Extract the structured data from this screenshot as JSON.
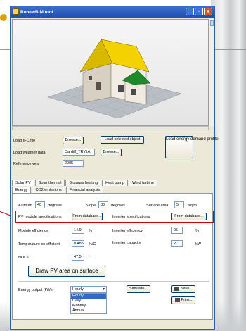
{
  "window": {
    "title": "RenewBIM tool",
    "controls": [
      "_",
      "▫",
      "x"
    ]
  },
  "top": {
    "load_ifc_label": "Load IFC file",
    "browse_label": "Browse...",
    "load_selected_label": "Load selected object",
    "load_energy_label": "Load energy demand profile",
    "weather_label": "Load weather data",
    "weather_value": "Cardiff_TRY.txt",
    "browse2_label": "Browse...",
    "ref_year_label": "Reference year",
    "ref_year_value": "2005"
  },
  "tabs_row1": [
    "Solar PV",
    "Solar thermal",
    "Biomass heating",
    "Heat pump",
    "Wind turbine"
  ],
  "tabs_row2": [
    "Energy",
    "CO2 emissions",
    "Financial analysis"
  ],
  "pv": {
    "azimuth_label": "Azimuth",
    "azimuth_value": "40",
    "azimuth_unit": "degrees",
    "slope_label": "Slope",
    "slope_value": "30",
    "slope_unit": "degrees",
    "surface_label": "Surface area",
    "surface_value": "5",
    "surface_unit": "sq m",
    "module_spec_label": "PV module specifications",
    "module_spec_btn": "From database...",
    "inverter_spec_label": "Inverter specifications",
    "inverter_spec_btn": "From database...",
    "module_eff_label": "Module efficiency",
    "module_eff_value": "14.9",
    "module_eff_unit": "%",
    "inverter_eff_label": "Inverter efficiency",
    "inverter_eff_value": "95",
    "inverter_eff_unit": "%",
    "temp_coef_label": "Temperature co-efficient",
    "temp_coef_value": "0.485",
    "temp_coef_unit": "%/C",
    "inverter_cap_label": "Inverter capacity",
    "inverter_cap_value": "2",
    "inverter_cap_unit": "kW",
    "noct_label": "NOCT",
    "noct_value": "47.5",
    "noct_unit": "C",
    "draw_btn": "Draw PV area on surface",
    "output_label": "Energy output (kWh)",
    "output_selected": "Hourly",
    "output_options": [
      "Hourly",
      "Daily",
      "Monthly",
      "Annual"
    ],
    "simulate_btn": "Simulate...",
    "save_btn": "Save...",
    "print_btn": "Print..."
  }
}
